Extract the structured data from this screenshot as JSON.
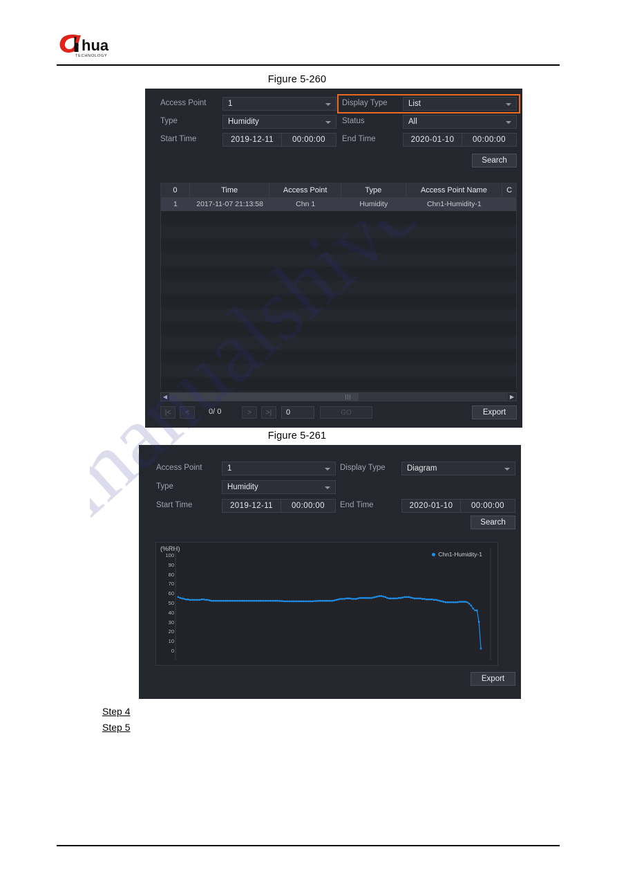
{
  "document": {
    "brand": "dahua",
    "brand_sub": "TECHNOLOGY",
    "watermark": "manualshive.com"
  },
  "figures": [
    {
      "caption": "Figure 5-260",
      "form": {
        "access_point_label": "Access Point",
        "access_point_value": "1",
        "display_type_label": "Display Type",
        "display_type_value": "List",
        "type_label": "Type",
        "type_value": "Humidity",
        "status_label": "Status",
        "status_value": "All",
        "start_time_label": "Start Time",
        "start_date_value": "2019-12-11",
        "start_clock_value": "00:00:00",
        "end_time_label": "End Time",
        "end_date_value": "2020-01-10",
        "end_clock_value": "00:00:00",
        "search_label": "Search"
      },
      "table": {
        "headers": [
          "0",
          "Time",
          "Access Point",
          "Type",
          "Access Point Name",
          "C"
        ],
        "rows": [
          [
            "1",
            "2017-11-07 21:13:58",
            "Chn 1",
            "Humidity",
            "Chn1-Humidity-1",
            ""
          ]
        ],
        "empty_row_count": 14
      },
      "footer": {
        "page_indicator": "0/ 0",
        "page_input_value": "0",
        "goto_label": "GO",
        "export_label": "Export",
        "first_label": "|<",
        "prev_label": "<",
        "next_label": ">",
        "last_label": ">|"
      }
    },
    {
      "caption": "Figure 5-261",
      "form": {
        "access_point_label": "Access Point",
        "access_point_value": "1",
        "display_type_label": "Display Type",
        "display_type_value": "Diagram",
        "type_label": "Type",
        "type_value": "Humidity",
        "start_time_label": "Start Time",
        "start_date_value": "2019-12-11",
        "start_clock_value": "00:00:00",
        "end_time_label": "End Time",
        "end_date_value": "2020-01-10",
        "end_clock_value": "00:00:00",
        "search_label": "Search"
      },
      "footer": {
        "export_label": "Export"
      }
    }
  ],
  "steps": [
    {
      "label": "Step 4"
    },
    {
      "label": "Step 5"
    }
  ],
  "colors": {
    "accent_highlight": "#ef6a21",
    "series": "#1f8fe8",
    "panel_bg": "#25272e",
    "table_bg": "#212329",
    "brand_red": "#e2231a"
  },
  "chart_data": {
    "type": "line",
    "title": "",
    "xlabel": "",
    "ylabel": "(%RH)",
    "ylim": [
      0,
      100
    ],
    "yticks": [
      100,
      90,
      80,
      70,
      60,
      50,
      40,
      30,
      20,
      10,
      0
    ],
    "grid": false,
    "legend_position": "top-right",
    "series": [
      {
        "name": "Chn1-Humidity-1",
        "color": "#1f8fe8",
        "values": [
          56,
          55,
          54.5,
          54,
          53.5,
          53.5,
          53,
          53,
          53,
          53,
          53,
          53,
          53.5,
          53.5,
          53,
          53,
          52.5,
          52,
          52,
          52,
          52,
          52,
          52,
          52,
          52,
          52,
          52,
          52,
          52,
          52,
          52,
          52,
          52,
          52,
          52,
          52,
          52,
          52,
          52,
          52,
          52,
          52,
          52,
          52,
          52,
          52,
          52,
          52,
          52,
          52,
          52,
          52,
          51.8,
          51.8,
          51.5,
          51.5,
          51.5,
          51.5,
          51.5,
          51.5,
          51.5,
          51.5,
          51.5,
          51.5,
          51.5,
          51.5,
          51.5,
          51.5,
          51.5,
          51.5,
          51.8,
          51.8,
          52,
          52,
          52,
          52,
          52,
          52,
          52,
          52,
          52.5,
          53,
          53.5,
          54,
          54,
          54,
          54.5,
          54.5,
          54.5,
          54,
          54,
          54,
          54.5,
          55,
          55,
          55,
          55,
          55,
          55,
          55,
          55.5,
          56,
          56.5,
          57,
          57,
          56.5,
          56,
          55,
          54.5,
          54.5,
          54.5,
          54.5,
          54.5,
          55,
          55,
          55.5,
          56,
          56,
          56,
          55.5,
          55,
          54.5,
          54.5,
          54.5,
          54.5,
          54,
          54,
          53.5,
          53.5,
          53.5,
          53.5,
          53,
          53,
          52.5,
          52,
          51.5,
          51,
          50.5,
          50.5,
          50.5,
          50.5,
          50.5,
          50.5,
          50.5,
          51,
          51,
          51,
          51,
          50.5,
          49,
          47,
          44,
          42,
          42,
          30,
          2
        ]
      }
    ]
  }
}
